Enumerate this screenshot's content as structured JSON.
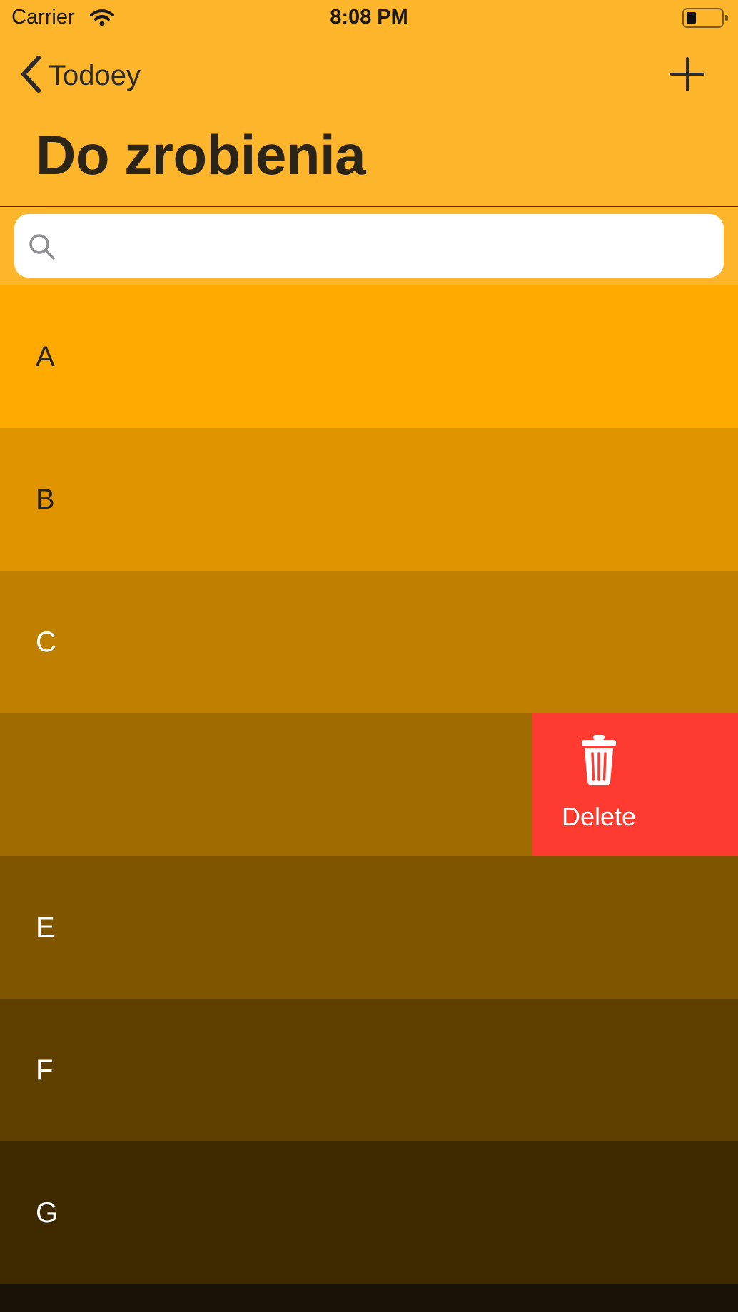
{
  "status": {
    "carrier": "Carrier",
    "time": "8:08 PM"
  },
  "nav": {
    "back_label": "Todoey",
    "title": "Do zrobienia"
  },
  "search": {
    "placeholder": "",
    "value": ""
  },
  "rows": [
    {
      "label": "A",
      "bg": "#ffaa00",
      "color": "#2a2418"
    },
    {
      "label": "B",
      "bg": "#e09500",
      "color": "#2a2418"
    },
    {
      "label": "C",
      "bg": "#bf7f00",
      "color": "#ffffff"
    },
    {
      "label": "",
      "bg": "#9f6a00",
      "color": "#ffffff"
    },
    {
      "label": "E",
      "bg": "#7f5500",
      "color": "#ffffff"
    },
    {
      "label": "F",
      "bg": "#5f3f00",
      "color": "#ffffff"
    },
    {
      "label": "G",
      "bg": "#3f2a00",
      "color": "#ffffff"
    }
  ],
  "swipe_action": {
    "label": "Delete",
    "color": "#fe3b30"
  },
  "colors": {
    "nav_bar": "#fdb52b"
  }
}
